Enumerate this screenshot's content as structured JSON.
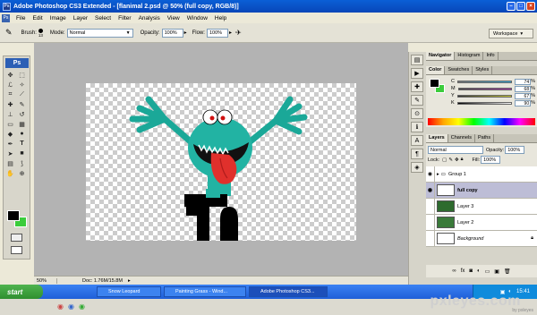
{
  "window": {
    "title": "Adobe Photoshop CS3 Extended - [flanimal 2.psd @ 50% (full copy, RGB/8)]",
    "ps_icon": "Ps",
    "buttons": [
      "minimize",
      "maximize",
      "close"
    ]
  },
  "menu": [
    "File",
    "Edit",
    "Image",
    "Layer",
    "Select",
    "Filter",
    "Analysis",
    "View",
    "Window",
    "Help"
  ],
  "options": {
    "brush_label": "Brush:",
    "brush_size": "13",
    "mode_label": "Mode:",
    "mode_value": "Normal",
    "opacity_label": "Opacity:",
    "opacity_value": "100%",
    "flow_label": "Flow:",
    "flow_value": "100%",
    "workspace": "Workspace"
  },
  "toolbox": {
    "badge": "Ps",
    "tools": [
      "move-icon",
      "marquee-icon",
      "lasso-icon",
      "wand-icon",
      "crop-icon",
      "slice-icon",
      "heal-icon",
      "brush-icon",
      "stamp-icon",
      "history-brush-icon",
      "eraser-icon",
      "gradient-icon",
      "blur-icon",
      "dodge-icon",
      "pen-icon",
      "type-icon",
      "path-select-icon",
      "shape-icon",
      "notes-icon",
      "eyedropper-icon",
      "hand-icon",
      "zoom-icon"
    ],
    "fg_color": "#000000",
    "bg_color": "#3bcc3b"
  },
  "status": {
    "zoom": "50%",
    "doc": "Doc: 1.76M/15.8M"
  },
  "navigator_tabs": [
    "Navigator",
    "Histogram",
    "Info"
  ],
  "color_tabs": [
    "Color",
    "Swatches",
    "Styles"
  ],
  "color_sliders": [
    {
      "label": "C",
      "value": "74",
      "unit": "%"
    },
    {
      "label": "M",
      "value": "68",
      "unit": "%"
    },
    {
      "label": "Y",
      "value": "67",
      "unit": "%"
    },
    {
      "label": "K",
      "value": "90",
      "unit": "%"
    }
  ],
  "layers_tabs": [
    "Layers",
    "Channels",
    "Paths"
  ],
  "layers": {
    "blend": "Normal",
    "opacity_label": "Opacity:",
    "opacity": "100%",
    "lock_label": "Lock:",
    "fill_label": "Fill:",
    "fill": "100%",
    "rows": [
      "Group 1",
      "full copy",
      "Layer 3",
      "Layer 2",
      "Background"
    ]
  },
  "taskbar": {
    "start": "start",
    "tasks": [
      "Snow Leopard",
      "Painting Grass - Wind...",
      "Adobe Photoshop CS3..."
    ],
    "time": "15:41"
  },
  "watermark": {
    "brand": "pxleyes.com",
    "sub": "by pxleyes"
  }
}
